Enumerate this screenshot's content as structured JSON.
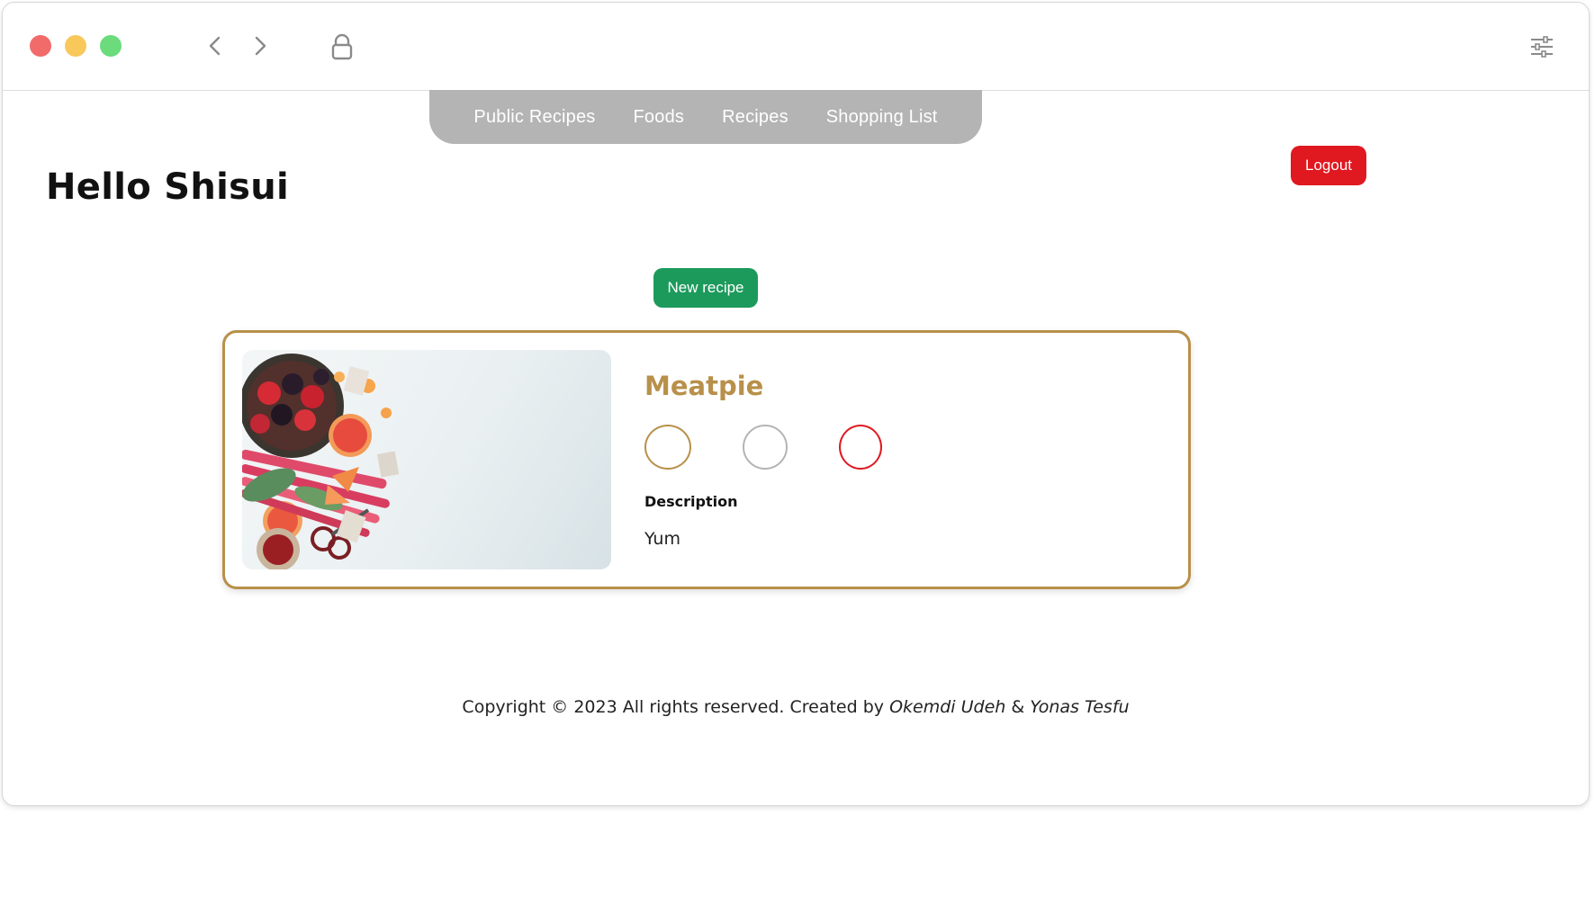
{
  "window": {
    "traffic_lights": {
      "close_color": "#f16b6b",
      "minimize_color": "#f8c85b",
      "maximize_color": "#6bdb7c"
    },
    "icons": [
      "chevron-left-icon",
      "chevron-right-icon",
      "lock-icon",
      "sliders-icon"
    ]
  },
  "topnav": {
    "items": [
      {
        "label": "Public Recipes"
      },
      {
        "label": "Foods"
      },
      {
        "label": "Recipes"
      },
      {
        "label": "Shopping List"
      }
    ],
    "background": "#b4b4b4"
  },
  "header": {
    "greeting": "Hello Shisui",
    "logout_label": "Logout",
    "logout_color": "#e01820"
  },
  "main": {
    "new_recipe_label": "New recipe",
    "new_recipe_color": "#1c9a5c",
    "recipe": {
      "title": "Meatpie",
      "title_color": "#b8904a",
      "description_label": "Description",
      "description": "Yum",
      "actions": [
        {
          "name": "gold-circle",
          "color": "#b8904a"
        },
        {
          "name": "gray-circle",
          "color": "#b4b4b4"
        },
        {
          "name": "red-circle",
          "color": "#dd1a22"
        }
      ]
    }
  },
  "footer": {
    "prefix": "Copyright © 2023 All rights reserved. Created by",
    "author1": "Okemdi Udeh",
    "separator": "&",
    "author2": "Yonas Tesfu"
  }
}
